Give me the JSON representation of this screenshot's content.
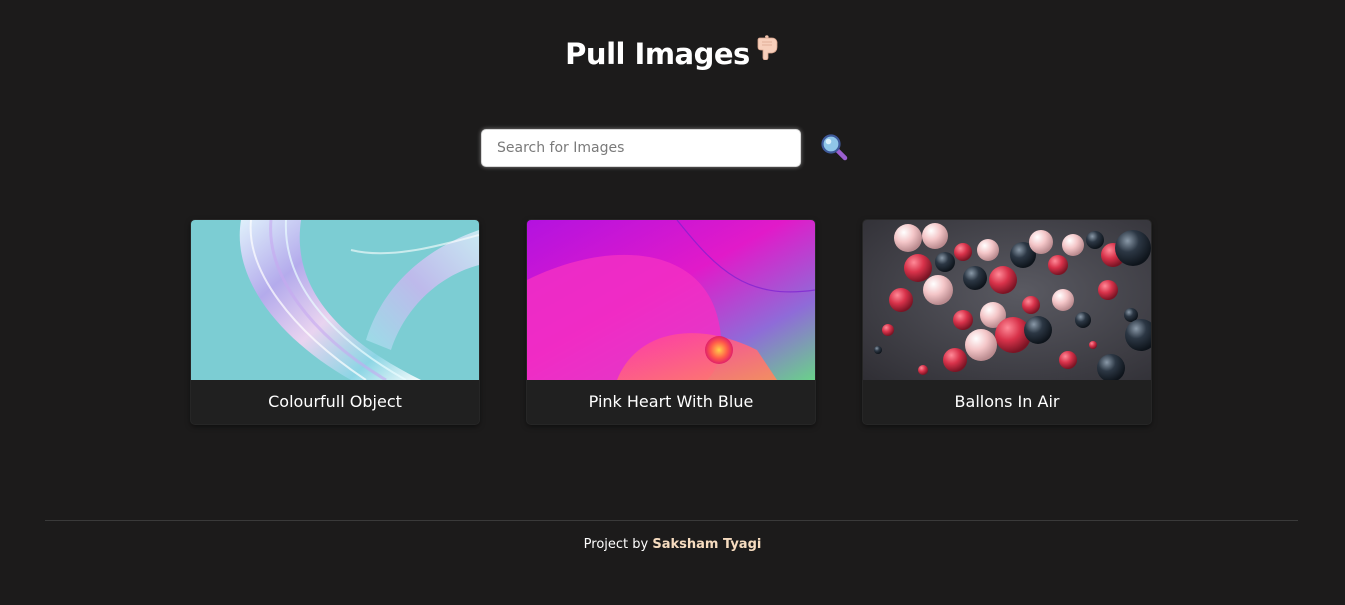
{
  "header": {
    "title": "Pull Images",
    "title_icon": "backhand-index-pointing-down"
  },
  "search": {
    "placeholder": "Search for Images",
    "value": "",
    "button_icon": "magnifying-glass-icon"
  },
  "gallery": {
    "cards": [
      {
        "caption": "Colourfull Object",
        "image": "iridescent-glass-ribbon"
      },
      {
        "caption": "Pink Heart With Blue",
        "image": "pink-purple-gradient-shapes"
      },
      {
        "caption": "Ballons In Air",
        "image": "floating-spheres"
      }
    ]
  },
  "footer": {
    "prefix": "Project by",
    "author": "Saksham Tyagi"
  },
  "colors": {
    "background": "#1c1b1b",
    "card": "#202020",
    "author_accent": "#f6dcc0"
  }
}
